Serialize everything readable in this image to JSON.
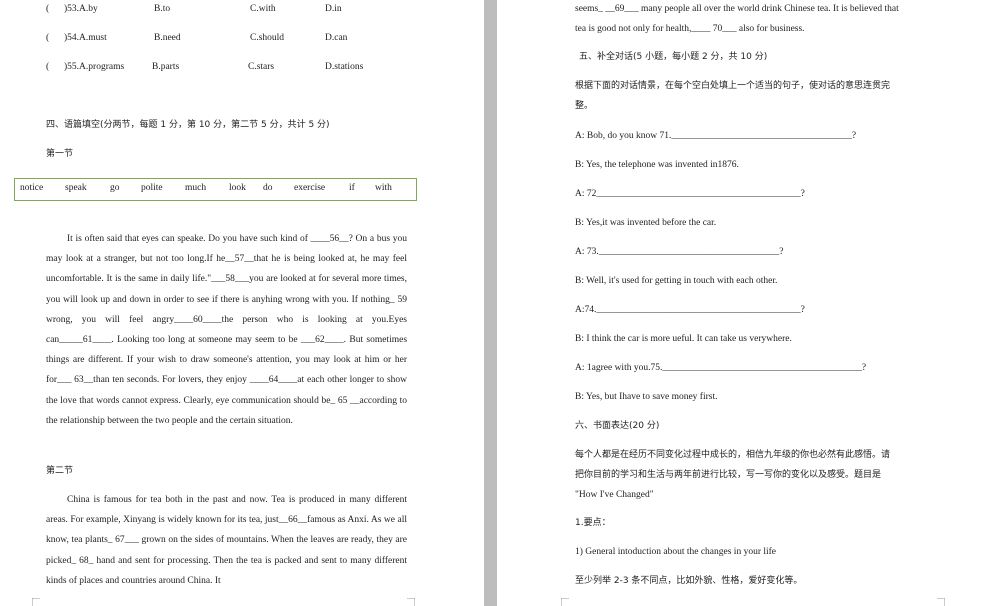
{
  "left": {
    "q53": {
      "paren": "(",
      "num": ")53.A.by",
      "b": "B.to",
      "c": "C.with",
      "d": "D.in"
    },
    "q54": {
      "paren": "(",
      "num": ")54.A.must",
      "b": "B.need",
      "c": "C.should",
      "d": "D.can"
    },
    "q55": {
      "paren": "(",
      "num": ")55.A.programs",
      "b": "B.parts",
      "c": "C.stars",
      "d": "D.stations"
    },
    "section4_title": "四、语篇填空(分两节，每题 1 分，第 10 分，第二节 5 分，共计 5 分)",
    "part1_title": "第一节",
    "word_bank": [
      "notice",
      "speak",
      "go",
      "polite",
      "much",
      "look",
      "do",
      "exercise",
      "if",
      "with"
    ],
    "passage1": [
      "It is often said that eyes can speake. Do you have such kind of ____56__? On a",
      "bus you may look at a stranger, but not too long.If he__57__that he is being looked at,",
      "he may feel uncomfortable. It is the same in daily life.\"___58___you are looked at for",
      "several more times, you will look up and down in order to see if there is anyhing",
      "wrong with you. If nothing_ 59 wrong, you will feel angry____60____the person who",
      "is looking at you.Eyes can_____61____. Looking too long at someone may seem to",
      "be ___62____. But sometimes things are different. If your wish to draw someone's",
      "attention, you may look at him or her for___ 63__than ten seconds. For lovers, they",
      "enjoy ____64____at each other longer to show the love that words cannot express.",
      "Clearly, eye communication should be_ 65 __according to the relationship between",
      "the two people and the certain situation."
    ],
    "part2_title": "第二节",
    "passage2": [
      "China is famous for tea both in the past and now. Tea is produced in many",
      "different areas. For example, Xinyang is widely known for its tea, just__66__famous",
      "as Anxi. As we all know, tea plants_ 67___ grown on the sides of mountains. When",
      "the leaves are ready, they are picked_ 68_ hand and sent for processing. Then the tea",
      "is packed and sent to many different kinds of places and countries around China. It"
    ]
  },
  "right": {
    "line1": "seems_ __69___ many people all over the world drink Chinese tea. It is believed that",
    "line2": "tea is good not only for health,____ 70___ also for business.",
    "section5_title": "五、补全对话(5 小题，每小题 2 分，共 10 分)",
    "section5_instr1": "根据下面的对话情景，在每个空白处填上一个适当的句子，使对话的意思连贯完",
    "section5_instr2": "整。",
    "dialogue": [
      "A: Bob, do you know 71.______________________________________?",
      "B: Yes, the telephone was invented in1876.",
      "A: 72___________________________________________?",
      "B: Yes,it was invented before the car.",
      "A: 73.______________________________________?",
      "B: Well, it's used for getting in touch with each other.",
      "A:74.___________________________________________?",
      "B: I think the car is more ueful. It can take us verywhere.",
      "A: 1agree with you.75.__________________________________________?",
      "B: Yes, but Ihave to save money first."
    ],
    "section6_title": "六、书面表达(20 分)",
    "section6_p1": "每个人都是在经历不同变化过程中成长的，相信九年级的你也必然有此感悟。请",
    "section6_p2": "把你目前的学习和生活与两年前进行比较，写一写你的变化以及感受。题目是",
    "section6_p3": "\"How I've Changed\"",
    "points_title": "1.要点：",
    "point1": "1) General intoduction about the changes in your life",
    "point2": "至少列举 2-3 条不同点，比如外貌、性格，爱好变化等。"
  }
}
